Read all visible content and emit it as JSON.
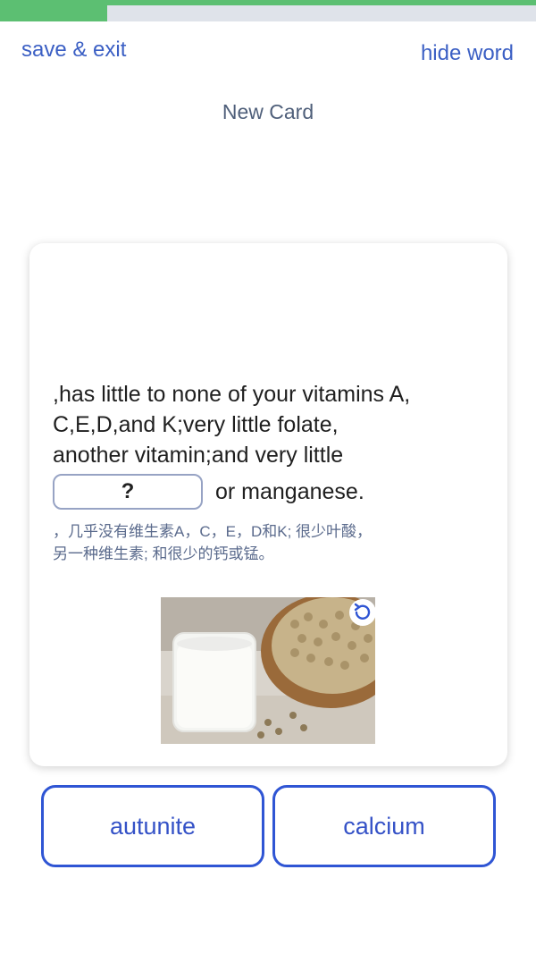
{
  "progress": {
    "fraction": 0.2
  },
  "header": {
    "save_exit": "save & exit",
    "hide_word": "hide word",
    "title": "New Card"
  },
  "card": {
    "sentence_lines": [
      ",has little to none of your vitamins A,",
      "C,E,D,and K;very little folate,",
      "another vitamin;and very little"
    ],
    "blank_label": "?",
    "sentence_end": "or manganese.",
    "translation_lines": [
      "，几乎没有维生素A，C，E，D和K; 很少叶酸，",
      "另一种维生素; 和很少的钙或锰。"
    ],
    "image_icon": "refresh-icon"
  },
  "choices": [
    {
      "label": "autunite"
    },
    {
      "label": "calcium"
    }
  ],
  "colors": {
    "accent": "#3b5fc4",
    "progress": "#5cbf72",
    "choice_border": "#2f55d4"
  }
}
